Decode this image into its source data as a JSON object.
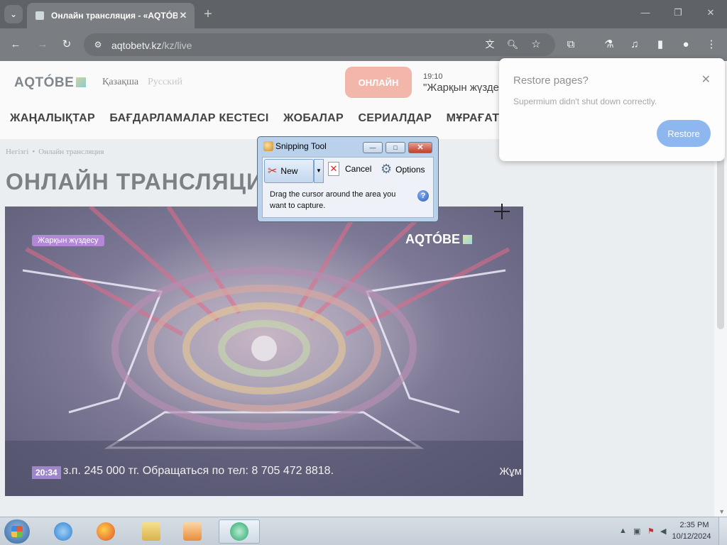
{
  "browser": {
    "tab_title": "Онлайн трансляция - «AQTÓBE»",
    "new_tab": "+",
    "url_host": "aqtobetv.kz",
    "url_path": "/kz/live"
  },
  "site": {
    "logo": "AQTÓBE",
    "lang_kz": "Қазақша",
    "lang_ru": "Русский",
    "live_button": "ОНЛАЙН",
    "program_time": "19:10",
    "program_title": "\"Жарқын жүздесу\"",
    "nav": [
      "ЖАҢАЛЫҚТАР",
      "БАҒДАРЛАМАЛАР КЕСТЕСІ",
      "ЖОБАЛАР",
      "СЕРИАЛДАР",
      "МҰРАҒАТ"
    ],
    "breadcrumb_home": "Негізгі",
    "breadcrumb_sep": "•",
    "breadcrumb_current": "Онлайн трансляция",
    "page_title": "ОНЛАЙН ТРАНСЛЯЦИЯ"
  },
  "video": {
    "badge": "Жарқын жүздесу",
    "logo": "AQTÓBE",
    "clock": "20:34",
    "ticker": "з.п. 245 000 тг. Обращаться по тел: 8 705 472 8818.",
    "ticker_right": "Жұм"
  },
  "restore_popup": {
    "title": "Restore pages?",
    "message": "Supermium didn't shut down correctly.",
    "button": "Restore",
    "close": "✕"
  },
  "snipping_tool": {
    "title": "Snipping Tool",
    "new_label": "New",
    "cancel_label": "Cancel",
    "options_label": "Options",
    "message": "Drag the cursor around the area you want to capture.",
    "help": "?",
    "btn_min": "—",
    "btn_max": "□",
    "btn_close": "✕"
  },
  "taskbar": {
    "time": "2:35 PM",
    "date": "10/12/2024"
  }
}
